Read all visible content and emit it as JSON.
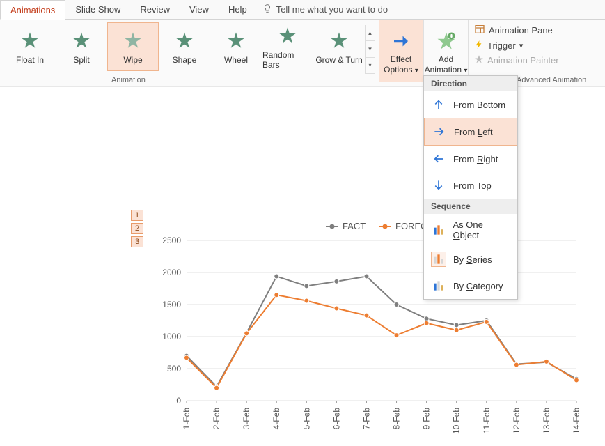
{
  "tabs": {
    "animations": "Animations",
    "slideshow": "Slide Show",
    "review": "Review",
    "view": "View",
    "help": "Help",
    "tellme": "Tell me what you want to do"
  },
  "gallery": {
    "floatin": "Float In",
    "split": "Split",
    "wipe": "Wipe",
    "shape": "Shape",
    "wheel": "Wheel",
    "randombars": "Random Bars",
    "growturn": "Grow & Turn",
    "group_label": "Animation"
  },
  "bigbtn": {
    "effect1": "Effect",
    "effect2": "Options",
    "add1": "Add",
    "add2": "Animation"
  },
  "adv": {
    "pane": "Animation Pane",
    "trigger": "Trigger",
    "painter": "Animation Painter",
    "group_label": "Advanced Animation"
  },
  "dropdown": {
    "h1": "Direction",
    "from_bottom_pre": "From ",
    "from_bottom_u": "B",
    "from_bottom_post": "ottom",
    "from_left_pre": "From ",
    "from_left_u": "L",
    "from_left_post": "eft",
    "from_right_pre": "From ",
    "from_right_u": "R",
    "from_right_post": "ight",
    "from_top_pre": "From ",
    "from_top_u": "T",
    "from_top_post": "op",
    "h2": "Sequence",
    "asone_pre": "As One ",
    "asone_u": "O",
    "asone_post": "bject",
    "byseries_pre": "By ",
    "byseries_u": "S",
    "byseries_post": "eries",
    "bycat_pre": "By ",
    "bycat_u": "C",
    "bycat_post": "ategory"
  },
  "seq": {
    "t1": "1",
    "t2": "2",
    "t3": "3"
  },
  "chart_data": {
    "type": "line",
    "title": "",
    "xlabel": "",
    "ylabel": "",
    "ylim": [
      0,
      2500
    ],
    "yticks": [
      0,
      500,
      1000,
      1500,
      2000,
      2500
    ],
    "categories": [
      "1-Feb",
      "2-Feb",
      "3-Feb",
      "4-Feb",
      "5-Feb",
      "6-Feb",
      "7-Feb",
      "8-Feb",
      "9-Feb",
      "10-Feb",
      "11-Feb",
      "12-Feb",
      "13-Feb",
      "14-Feb"
    ],
    "series": [
      {
        "name": "FACT",
        "color": "#7f7f7f",
        "values": [
          700,
          220,
          1060,
          1940,
          1790,
          1860,
          1940,
          1500,
          1280,
          1180,
          1250,
          570,
          600,
          340
        ]
      },
      {
        "name": "FORECAST",
        "color": "#ed7d31",
        "values": [
          670,
          200,
          1050,
          1650,
          1560,
          1440,
          1330,
          1020,
          1210,
          1100,
          1230,
          560,
          610,
          320
        ]
      }
    ],
    "legend_position": "top"
  }
}
